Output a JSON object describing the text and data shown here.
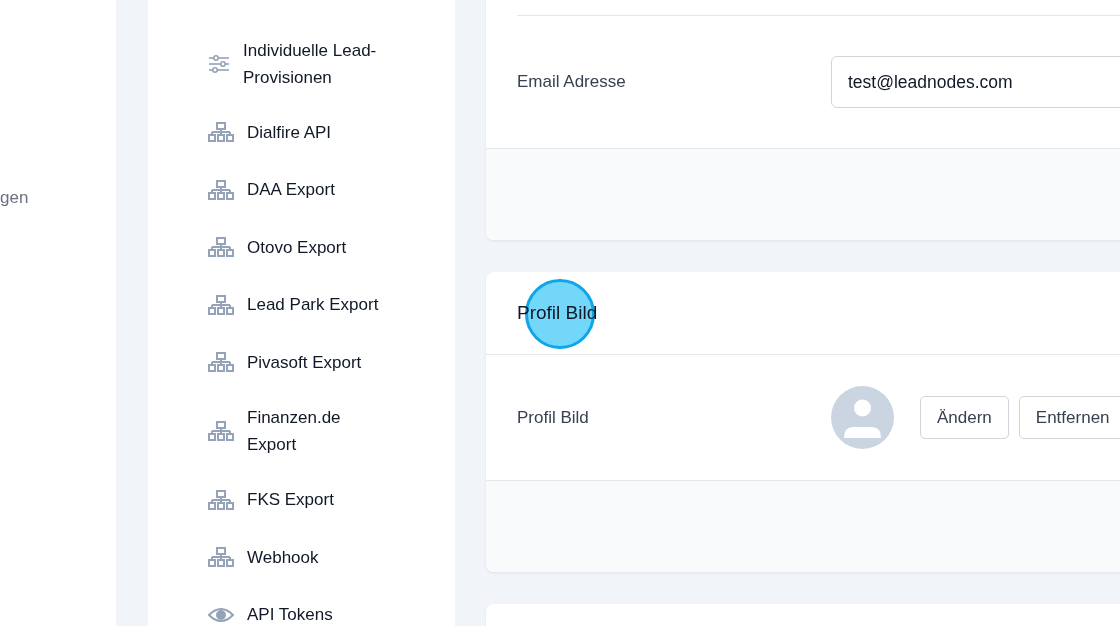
{
  "left_nav": {
    "partial_label": "gen"
  },
  "sidebar": {
    "items": [
      {
        "label": "Individuelle Lead-Provisionen",
        "kind": "sliders"
      },
      {
        "label": "Dialfire API",
        "kind": "network"
      },
      {
        "label": "DAA Export",
        "kind": "network"
      },
      {
        "label": "Otovo Export",
        "kind": "network"
      },
      {
        "label": "Lead Park Export",
        "kind": "network"
      },
      {
        "label": "Pivasoft Export",
        "kind": "network"
      },
      {
        "label": "Finanzen.de Export",
        "kind": "network"
      },
      {
        "label": "FKS Export",
        "kind": "network"
      },
      {
        "label": "Webhook",
        "kind": "network"
      },
      {
        "label": "API Tokens",
        "kind": "eye"
      }
    ]
  },
  "email_card": {
    "label": "Email Adresse",
    "value": "test@leadnodes.com"
  },
  "profile_card": {
    "title": "Profil Bild",
    "label": "Profil Bild",
    "buttons": [
      "Ändern",
      "Entfernen"
    ]
  }
}
